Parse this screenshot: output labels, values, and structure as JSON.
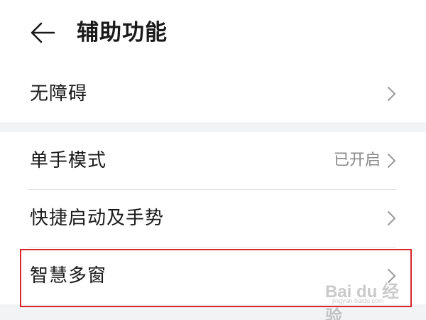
{
  "header": {
    "title": "辅助功能",
    "back_icon": "arrow-left-icon"
  },
  "rows": [
    {
      "label": "无障碍",
      "value": "",
      "icon": "chevron-right-icon"
    },
    {
      "label": "单手模式",
      "value": "已开启",
      "icon": "chevron-right-icon"
    },
    {
      "label": "快捷启动及手势",
      "value": "",
      "icon": "chevron-right-icon"
    },
    {
      "label": "智慧多窗",
      "value": "",
      "icon": "chevron-right-icon"
    }
  ],
  "watermark": {
    "brand": "Bai du 经验",
    "url": "jingyan.baidu.com"
  },
  "colors": {
    "text": "#1a1a1a",
    "secondary_text": "#8a8a8a",
    "chevron": "#9a9a9a",
    "divider": "#e3e3e3",
    "section_gap": "#f1f3f5",
    "highlight": "#d9262b"
  }
}
